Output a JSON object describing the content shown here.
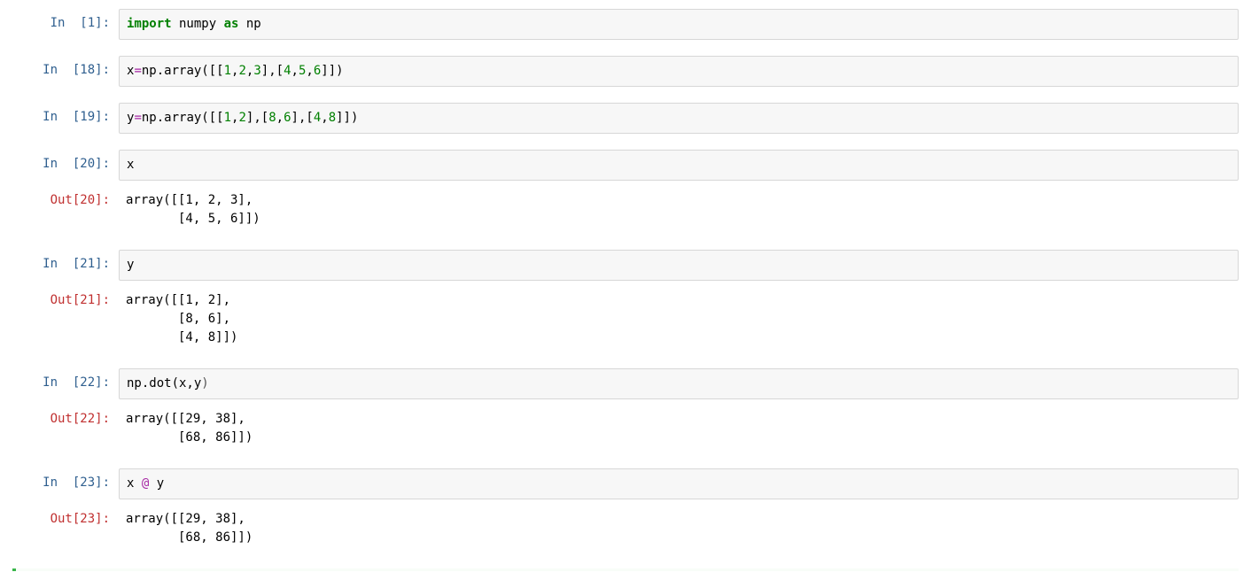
{
  "cells": [
    {
      "in_num": "1",
      "code_html": "<span class='kw-green'>import</span> numpy <span class='kw-as'>as</span> np"
    },
    {
      "in_num": "18",
      "code_html": "x<span class='op'>=</span>np.array([[<span class='num'>1</span>,<span class='num'>2</span>,<span class='num'>3</span>],[<span class='num'>4</span>,<span class='num'>5</span>,<span class='num'>6</span>]])"
    },
    {
      "in_num": "19",
      "code_html": "y<span class='op'>=</span>np.array([[<span class='num'>1</span>,<span class='num'>2</span>],[<span class='num'>8</span>,<span class='num'>6</span>],[<span class='num'>4</span>,<span class='num'>8</span>]])"
    },
    {
      "in_num": "20",
      "code_html": "x",
      "out_num": "20",
      "out_text": "array([[1, 2, 3],\n       [4, 5, 6]])"
    },
    {
      "in_num": "21",
      "code_html": "y",
      "out_num": "21",
      "out_text": "array([[1, 2],\n       [8, 6],\n       [4, 8]])"
    },
    {
      "in_num": "22",
      "code_html": "np.dot(x,y<span class='paren'>)</span>",
      "out_num": "22",
      "out_text": "array([[29, 38],\n       [68, 86]])"
    },
    {
      "in_num": "23",
      "code_html": "x <span class='op'>@</span> y",
      "out_num": "23",
      "out_text": "array([[29, 38],\n       [68, 86]])"
    }
  ],
  "labels": {
    "in_prefix": "In  ",
    "out_prefix": "Out"
  }
}
